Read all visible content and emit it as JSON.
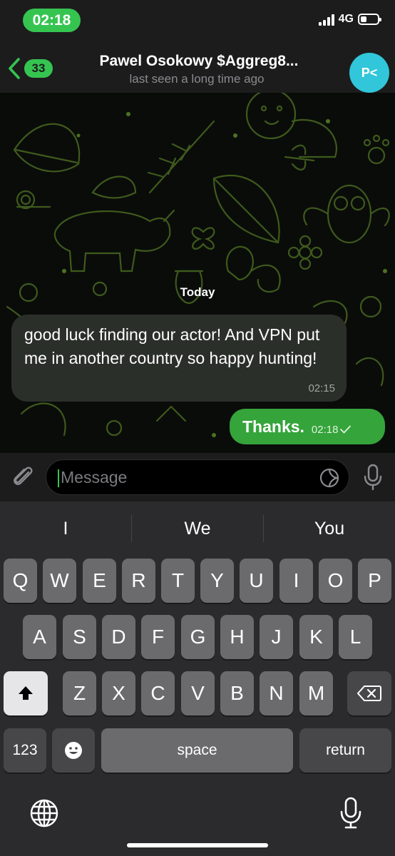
{
  "status_bar": {
    "time": "02:18",
    "network": "4G",
    "battery_level": 0.35
  },
  "header": {
    "unread_badge": "33",
    "title": "Pawel Osokowy $Aggreg8...",
    "subtitle": "last seen a long time ago",
    "avatar_initials": "P<",
    "avatar_color": "#31c6d9"
  },
  "chat": {
    "date_separator": "Today",
    "messages": [
      {
        "direction": "incoming",
        "text": "good luck finding our actor! And VPN put me in another country so happy hunting!",
        "time": "02:15"
      },
      {
        "direction": "outgoing",
        "text": "Thanks.",
        "time": "02:18"
      }
    ]
  },
  "input": {
    "placeholder": "Message"
  },
  "keyboard": {
    "suggestions": [
      "I",
      "We",
      "You"
    ],
    "row1": [
      "Q",
      "W",
      "E",
      "R",
      "T",
      "Y",
      "U",
      "I",
      "O",
      "P"
    ],
    "row2": [
      "A",
      "S",
      "D",
      "F",
      "G",
      "H",
      "J",
      "K",
      "L"
    ],
    "row3": [
      "Z",
      "X",
      "C",
      "V",
      "B",
      "N",
      "M"
    ],
    "numbers_label": "123",
    "space_label": "space",
    "return_label": "return"
  },
  "colors": {
    "accent": "#36c451",
    "outgoing_bubble": "#35a43b",
    "incoming_bubble": "#2b2f2a"
  }
}
